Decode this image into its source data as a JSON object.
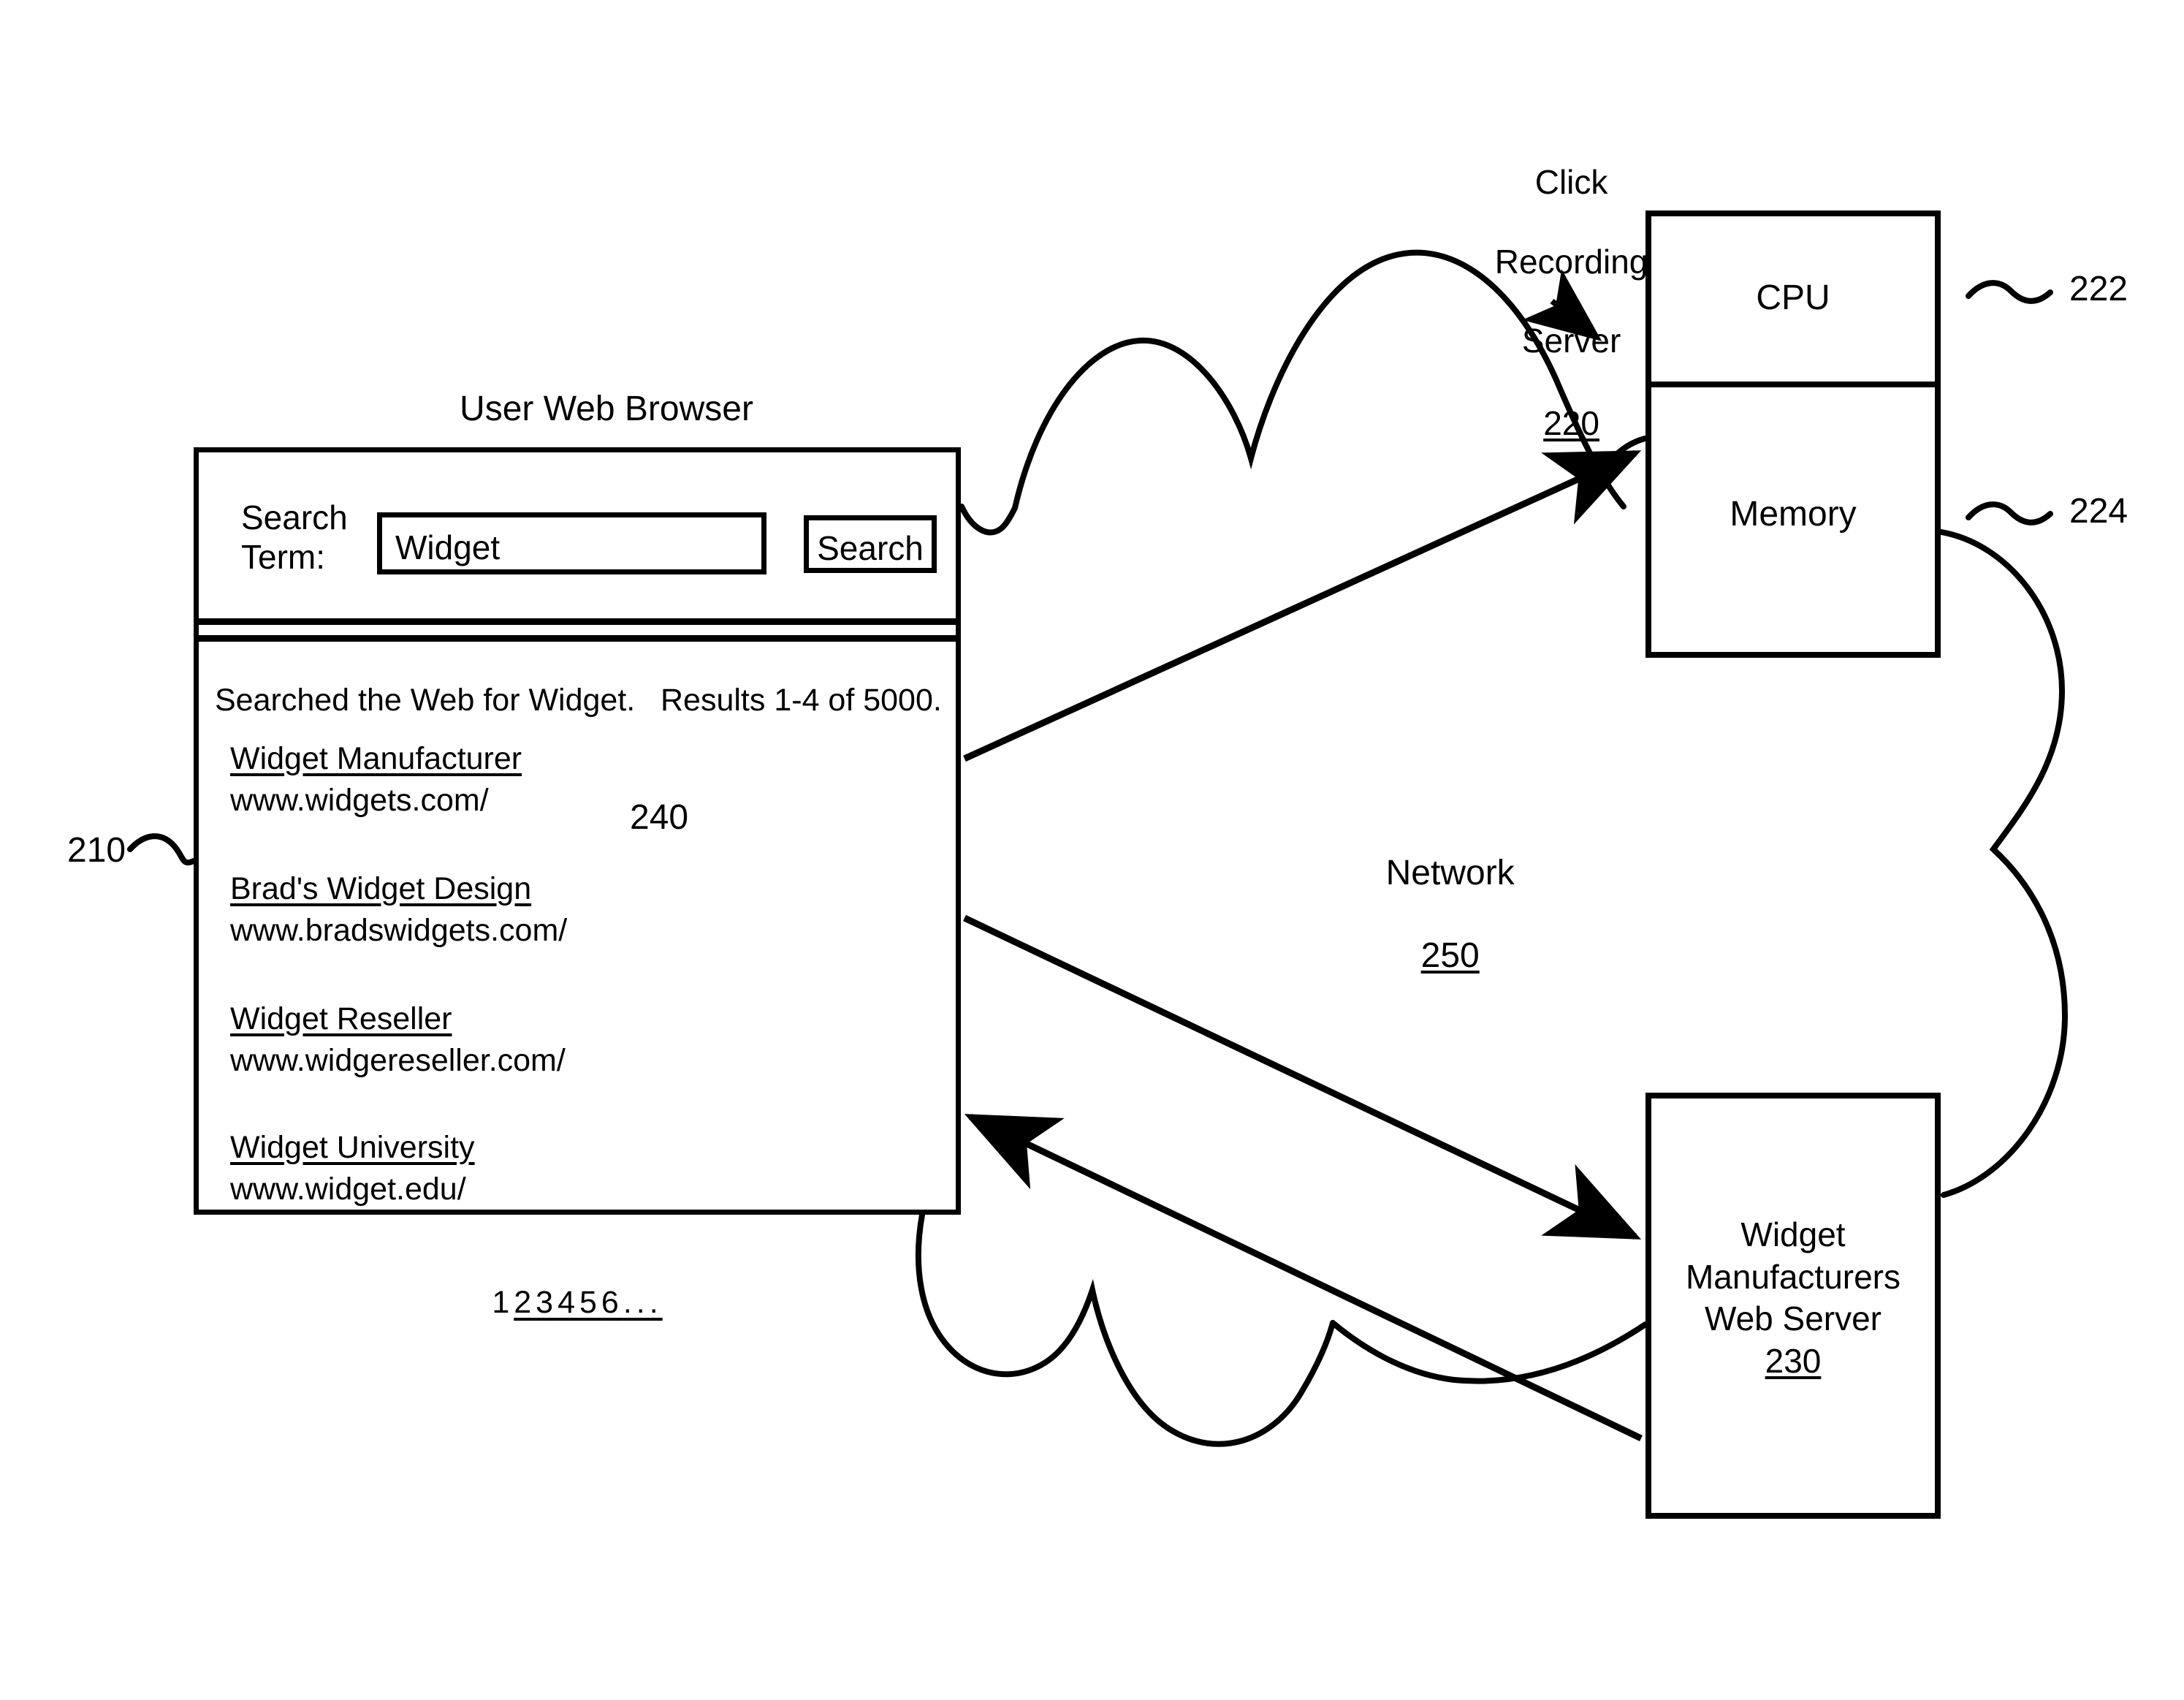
{
  "figure": {
    "kind": "patent-diagram",
    "stroke_color": "#000000",
    "background_color": "#ffffff"
  },
  "browser": {
    "title": "User Web Browser",
    "reference_numeral": "210",
    "toolbar": {
      "search_term_label": "Search\nTerm:",
      "search_input_value": "Widget",
      "search_input_placeholder": "Widget",
      "search_button_label": "Search"
    },
    "results": {
      "summary": "Searched the Web for Widget.",
      "count": "Results 1-4 of 5000.",
      "items": [
        {
          "title": "Widget Manufacturer",
          "url": "www.widgets.com/"
        },
        {
          "title": "Brad's Widget Design",
          "url": "www.bradswidgets.com/"
        },
        {
          "title": "Widget Reseller",
          "url": "www.widgereseller.com/"
        },
        {
          "title": "Widget University",
          "url": "www.widget.edu/"
        }
      ]
    },
    "pagination": {
      "pages": [
        "1",
        "2",
        "3",
        "4",
        "5",
        "6",
        "..."
      ],
      "current_page": "1"
    }
  },
  "cursor": {
    "icon": "mouse-pointer-icon",
    "reference_numeral": "240",
    "points_at": "Widget Manufacturer"
  },
  "click_recording_server": {
    "caption_line_1": "Click",
    "caption_line_2": "Recording",
    "caption_line_3": "Server",
    "reference_numeral": "220",
    "components": [
      {
        "label": "CPU",
        "reference_numeral": "222"
      },
      {
        "label": "Memory",
        "reference_numeral": "224"
      }
    ]
  },
  "network": {
    "label": "Network",
    "reference_numeral": "250",
    "icon": "cloud-icon"
  },
  "widget_manufacturers_web_server": {
    "label_line_1": "Widget",
    "label_line_2": "Manufacturers",
    "label_line_3": "Web Server",
    "reference_numeral": "230"
  }
}
